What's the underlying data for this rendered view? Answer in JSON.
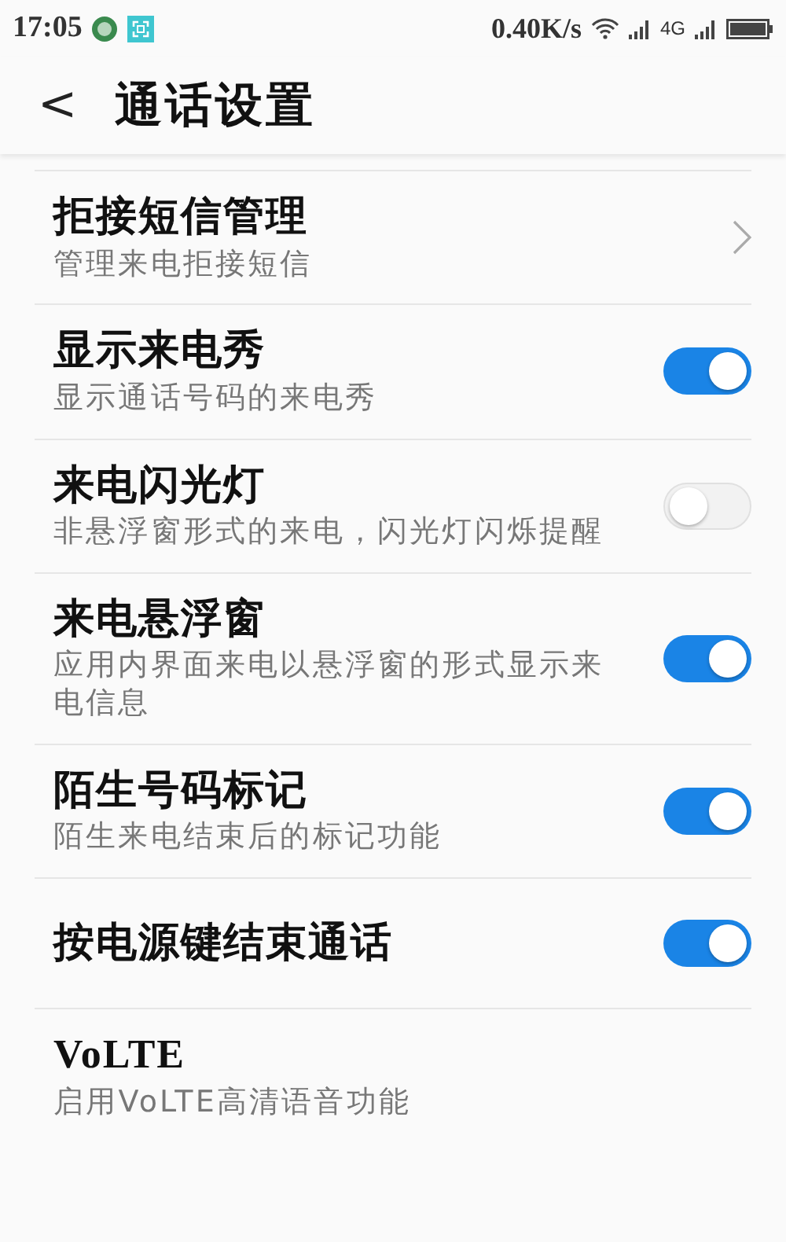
{
  "status_bar": {
    "time": "17:05",
    "speed": "0.40K/s",
    "network": "4G"
  },
  "header": {
    "back": "<",
    "title": "通话设置"
  },
  "settings": [
    {
      "kind": "link",
      "title": "拒接短信管理",
      "subtitle": "管理来电拒接短信"
    },
    {
      "kind": "toggle",
      "title": "显示来电秀",
      "subtitle": "显示通话号码的来电秀",
      "on": true
    },
    {
      "kind": "toggle",
      "title": "来电闪光灯",
      "subtitle": "非悬浮窗形式的来电，闪光灯闪烁提醒",
      "on": false
    },
    {
      "kind": "toggle",
      "title": "来电悬浮窗",
      "subtitle": "应用内界面来电以悬浮窗的形式显示来电信息",
      "on": true
    },
    {
      "kind": "toggle",
      "title": "陌生号码标记",
      "subtitle": "陌生来电结束后的标记功能",
      "on": true
    },
    {
      "kind": "toggle",
      "title": "按电源键结束通话",
      "on": true
    },
    {
      "kind": "plain",
      "title": "VoLTE",
      "subtitle": "启用VoLTE高清语音功能"
    }
  ]
}
